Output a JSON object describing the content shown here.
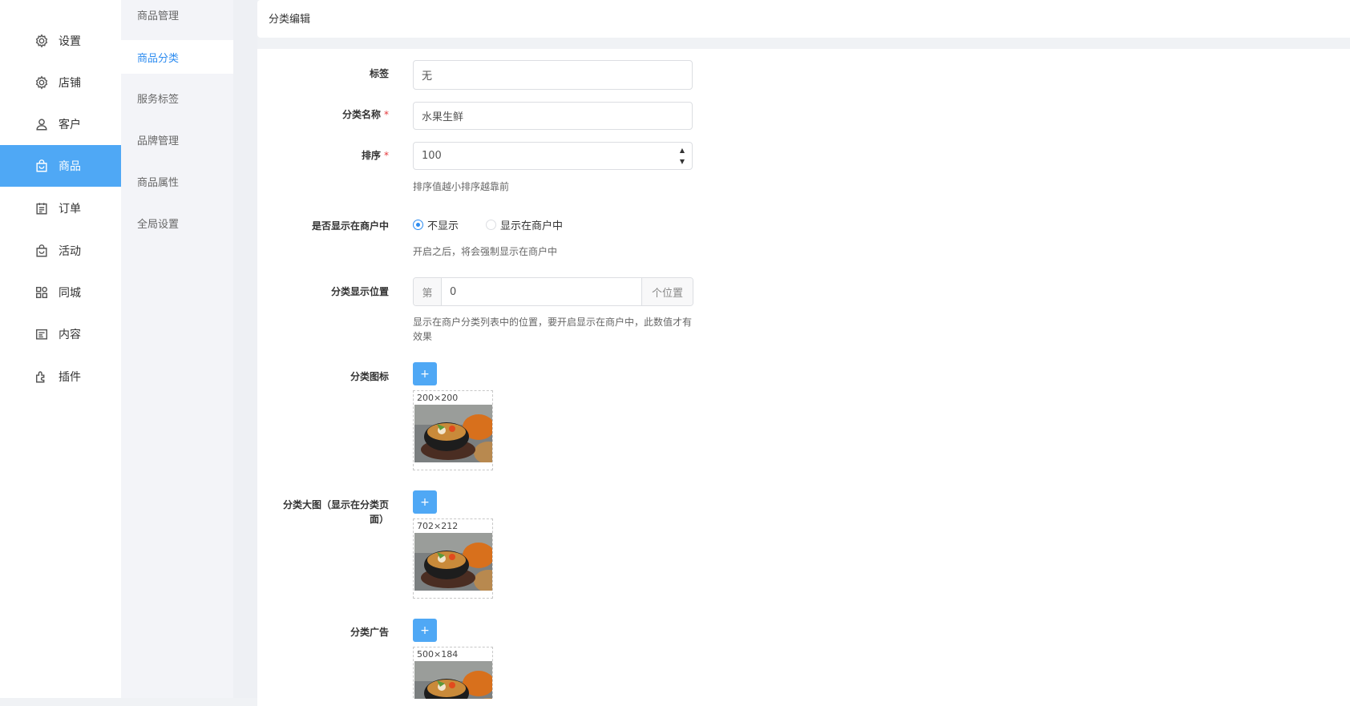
{
  "nav1": {
    "items": [
      {
        "label": "设置",
        "icon": "gear-icon"
      },
      {
        "label": "店铺",
        "icon": "gear-icon"
      },
      {
        "label": "客户",
        "icon": "user-icon"
      },
      {
        "label": "商品",
        "icon": "bag-icon"
      },
      {
        "label": "订单",
        "icon": "calendar-icon"
      },
      {
        "label": "活动",
        "icon": "bag-icon"
      },
      {
        "label": "同城",
        "icon": "grid-icon"
      },
      {
        "label": "内容",
        "icon": "document-icon"
      },
      {
        "label": "插件",
        "icon": "puzzle-icon"
      }
    ],
    "active_index": 3,
    "active_color": "#4fa8f5"
  },
  "nav2": {
    "items": [
      "商品管理",
      "商品分类",
      "服务标签",
      "品牌管理",
      "商品属性",
      "全局设置"
    ],
    "active_index": 1,
    "active_color": "#2d8cf0"
  },
  "header": {
    "title": "分类编辑"
  },
  "form": {
    "tag": {
      "label": "标签",
      "value": "无"
    },
    "name": {
      "label": "分类名称",
      "required_mark": "*",
      "value": "水果生鲜"
    },
    "sort": {
      "label": "排序",
      "required_mark": "*",
      "value": "100",
      "hint": "排序值越小排序越靠前",
      "up": "▲",
      "down": "▼"
    },
    "show_in_store": {
      "label": "是否显示在商户中",
      "options": [
        "不显示",
        "显示在商户中"
      ],
      "selected_index": 0,
      "hint": "开启之后，将会强制显示在商户中"
    },
    "position": {
      "label": "分类显示位置",
      "prefix": "第",
      "value": "0",
      "suffix": "个位置",
      "hint_line1": "显示在商户分类列表中的位置，要开启显示在商户中，此数值才有",
      "hint_line2": "效果"
    },
    "icon": {
      "label": "分类图标",
      "button": "+",
      "size": "200×200"
    },
    "banner": {
      "label_line1": "分类大图（显示在分类页",
      "label_line2": "面）",
      "button": "+",
      "size": "702×212"
    },
    "ad": {
      "label": "分类广告",
      "button": "+",
      "size": "500×184"
    }
  }
}
